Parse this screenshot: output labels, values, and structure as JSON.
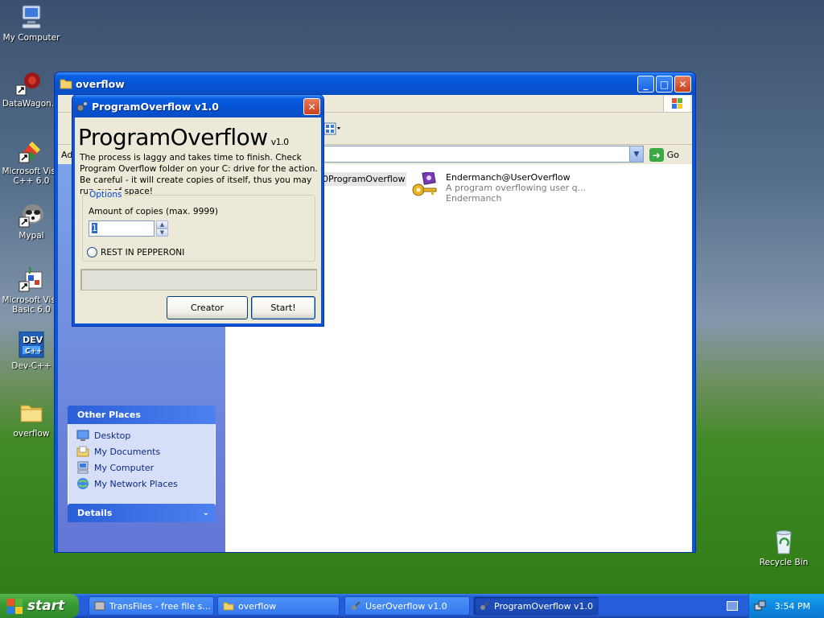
{
  "desktop": {
    "icons": [
      {
        "label": "My Computer",
        "icon": "computer-icon"
      },
      {
        "label": "DataWagon.",
        "icon": "datawagon-shortcut-icon"
      },
      {
        "label": "Microsoft Visu C++ 6.0",
        "icon": "visual-cpp-shortcut-icon"
      },
      {
        "label": "Mypal",
        "icon": "mypal-shortcut-icon"
      },
      {
        "label": "Microsoft Visu Basic 6.0",
        "icon": "visual-basic-shortcut-icon"
      },
      {
        "label": "Dev-C++",
        "icon": "devcpp-shortcut-icon"
      },
      {
        "label": "overflow",
        "icon": "folder-icon"
      },
      {
        "label": "Recycle Bin",
        "icon": "recycle-bin-icon"
      }
    ],
    "icon_labels": {
      "c": "My Computer",
      "d": "DataWagon.",
      "vc1": "Microsoft Visu",
      "vc2": "C++ 6.0",
      "mp": "Mypal",
      "vb1": "Microsoft Visu",
      "vb2": "Basic 6.0",
      "dev": "Dev-C++",
      "of": "overflow",
      "rb": "Recycle Bin"
    }
  },
  "explorer": {
    "title": "overflow",
    "address_label": "Ad",
    "go_label": "Go",
    "files": [
      {
        "name": "0ProgramOverflow"
      },
      {
        "name": "Endermanch@UserOverflow",
        "description": "A program overflowing user q...",
        "company": "Endermanch"
      }
    ],
    "other_places": {
      "header": "Other Places",
      "items": [
        "Desktop",
        "My Documents",
        "My Computer",
        "My Network Places"
      ]
    },
    "details": {
      "header": "Details"
    }
  },
  "dialog": {
    "title": "ProgramOverflow v1.0",
    "heading": "ProgramOverflow",
    "version": "v1.0",
    "description": "The process is laggy and takes time to finish. Check Program Overflow folder on your C: drive for the action. Be careful - it will create copies of itself, thus you may run our of space!",
    "options_legend": "Options",
    "copies_label": "Amount of copies (max. 9999)",
    "copies_value": "1",
    "radio_label": "REST IN PEPPERONI",
    "progress": 0,
    "creator_button": "Creator",
    "start_button": "Start!"
  },
  "taskbar": {
    "start_label": "start",
    "tasks": [
      {
        "label": "TransFiles - free file s..."
      },
      {
        "label": "overflow"
      },
      {
        "label": "UserOverflow v1.0"
      },
      {
        "label": "ProgramOverflow v1.0"
      }
    ],
    "clock": "3:54 PM"
  },
  "colors": {
    "titlebar": "#0a55d8",
    "start": "#3a9d33",
    "taskbar": "#245edb"
  }
}
